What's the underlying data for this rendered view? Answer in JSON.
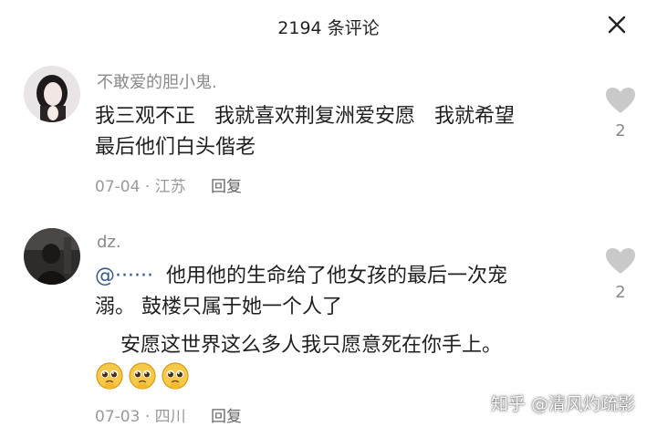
{
  "header": {
    "title": "2194 条评论",
    "close_icon": "close-icon"
  },
  "comments": [
    {
      "username": "不敢爱的胆小鬼.",
      "lines": [
        "我三观不正   我就喜欢荆复洲爱安愿   我就希望",
        "最后他们白头偕老"
      ],
      "date": "07-04",
      "location": "江苏",
      "reply": "回复",
      "likes": "2"
    },
    {
      "username": "dz.",
      "mention": "@······",
      "lines": [
        "  他用他的生命给了他女孩的最后一次宠",
        "溺。 鼓楼只属于她一个人了",
        "    安愿这世界这么多人我只愿意死在你手上。"
      ],
      "emojis": [
        "pleading-face-emoji",
        "pleading-face-emoji",
        "pleading-face-emoji"
      ],
      "date": "07-03",
      "location": "四川",
      "reply": "回复",
      "likes": "2"
    }
  ],
  "meta_separator": "·",
  "watermark": "知乎 @清风灼疏影"
}
